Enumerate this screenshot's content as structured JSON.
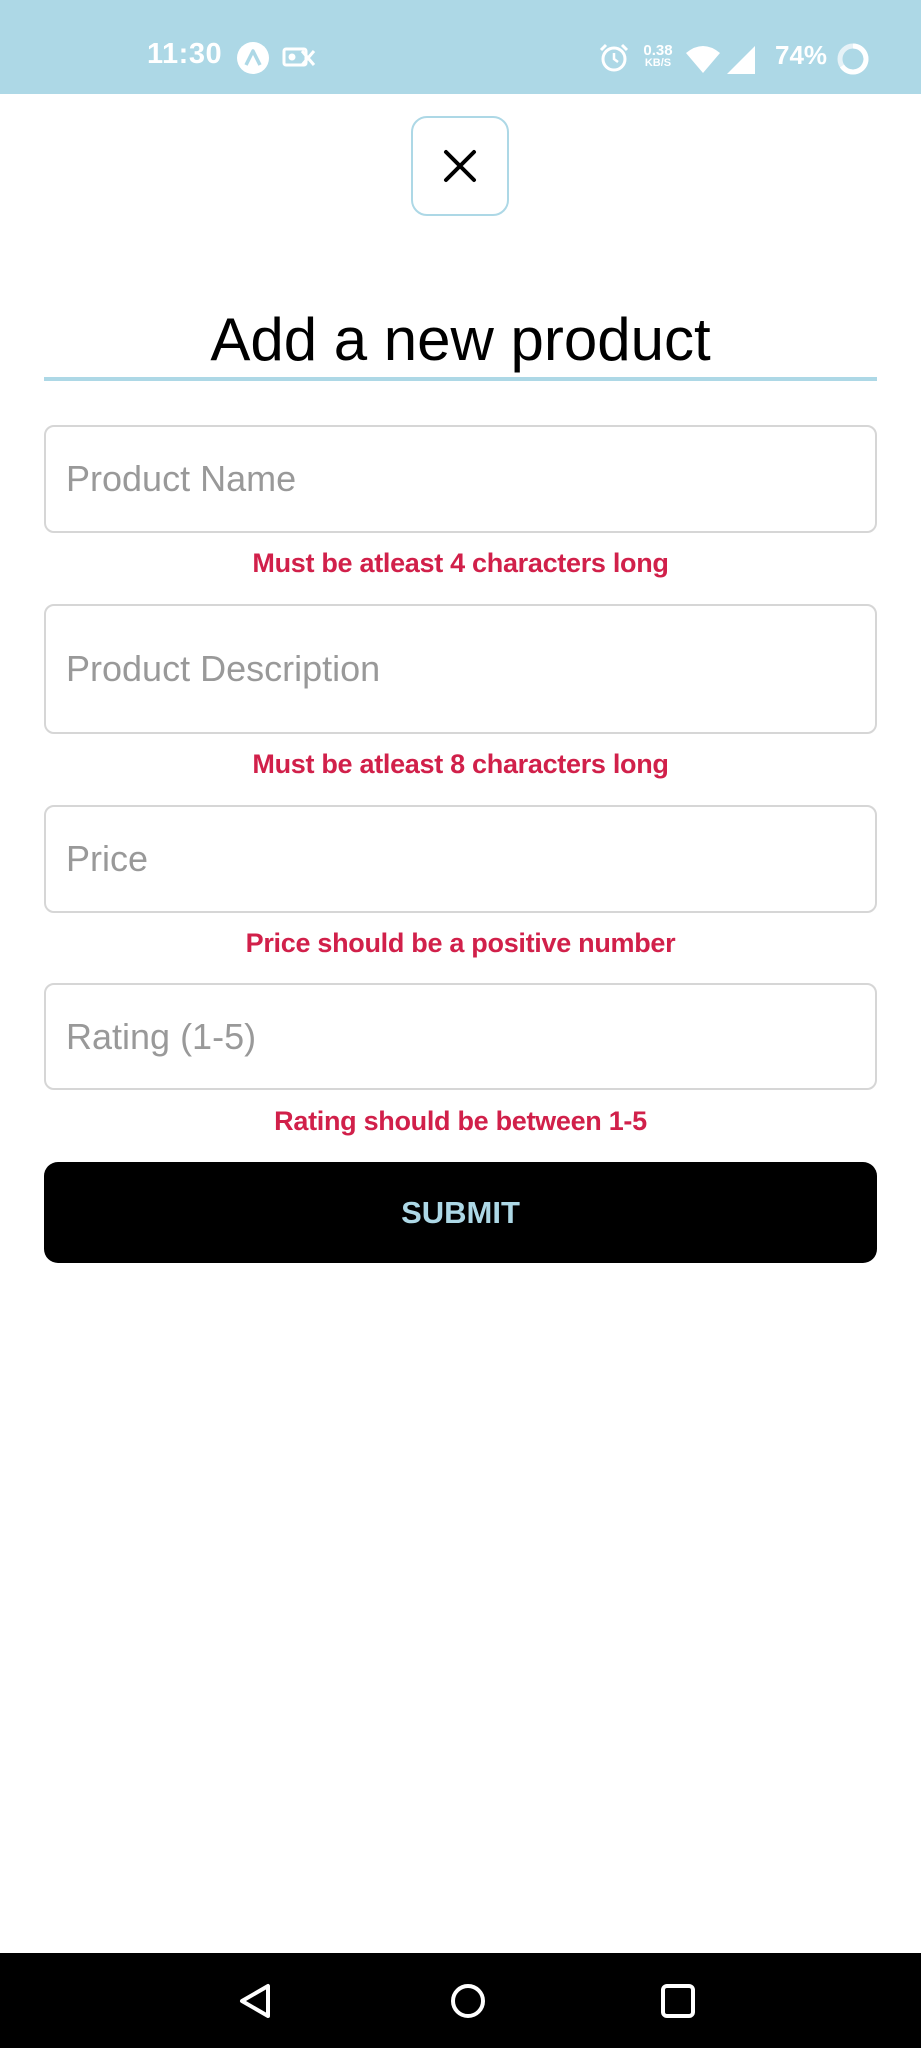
{
  "status_bar": {
    "time": "11:30",
    "net_speed": "0.38",
    "net_unit": "KB/S",
    "battery": "74%",
    "icons": [
      "app-a-icon",
      "cast-icon",
      "alarm-icon",
      "wifi-icon",
      "signal-icon",
      "battery-ring-icon"
    ],
    "background": "#add8e6"
  },
  "close_button": {
    "icon": "close-icon"
  },
  "title": "Add a new product",
  "form": {
    "fields": [
      {
        "placeholder": "Product Name",
        "value": "",
        "error": "Must be atleast 4 characters long"
      },
      {
        "placeholder": "Product Description",
        "value": "",
        "error": "Must be atleast 8 characters long"
      },
      {
        "placeholder": "Price",
        "value": "",
        "error": "Price should be a positive number"
      },
      {
        "placeholder": "Rating (1-5)",
        "value": "",
        "error": "Rating should be between 1-5"
      }
    ],
    "submit_label": "SUBMIT"
  },
  "nav_bar": {
    "icons": [
      "back-icon",
      "home-icon",
      "recents-icon"
    ]
  },
  "colors": {
    "accent": "#add8e6",
    "error": "#d1204a",
    "button_bg": "#000000"
  }
}
